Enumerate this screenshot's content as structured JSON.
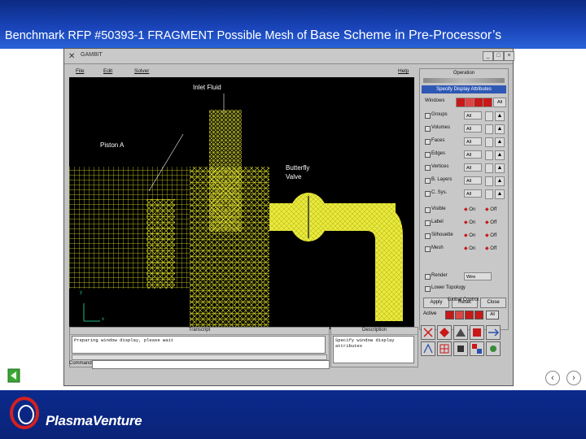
{
  "slide": {
    "title_main": "Benchmark  RFP #50393-1  FRAGMENT Possible Mesh of ",
    "title_emph": "Base Scheme in Pre-Processor’s",
    "brand": "PlasmaVenture"
  },
  "app": {
    "window_title": "GAMBIT",
    "menu": [
      "File",
      "Edit",
      "Solver",
      "Help"
    ],
    "canvas_labels": {
      "inlet": "Inlet Fluid",
      "piston": "Piston A",
      "butterfly": "Butterfly\nValve",
      "axis_y": "y",
      "axis_x": "x"
    },
    "operation": "Operation",
    "display_header": "Specify Display Attributes",
    "windows_label": "Windows",
    "all_label": "All",
    "entity_rows": [
      {
        "label": "Groups",
        "opt": "All"
      },
      {
        "label": "Volumes",
        "opt": "All"
      },
      {
        "label": "Faces",
        "opt": "All"
      },
      {
        "label": "Edges",
        "opt": "All"
      },
      {
        "label": "Vertices",
        "opt": "All"
      },
      {
        "label": "B. Layers",
        "opt": "All"
      },
      {
        "label": "C. Sys.",
        "opt": "All"
      }
    ],
    "toggle_rows": [
      {
        "label": "Visible",
        "on": "On",
        "off": "Off"
      },
      {
        "label": "Label",
        "on": "On",
        "off": "Off"
      },
      {
        "label": "Silhouette",
        "on": "On",
        "off": "Off"
      },
      {
        "label": "Mesh",
        "on": "On",
        "off": "Off"
      }
    ],
    "render_label": "Render",
    "render_value": "Wire",
    "lower_topology": "Lower Topology",
    "buttons": [
      "Apply",
      "Reset",
      "Close"
    ],
    "global_control": "Global Control",
    "active_label": "Active",
    "transcript_title": "Transcript",
    "transcript_text": "Preparing window display, please wait",
    "command_label": "Command:",
    "description_title": "Description",
    "description_text": "Specify window display attributes",
    "status_corner": "GAMBIT"
  },
  "colors": {
    "mesh": "#e6e62a",
    "fluid_fill": "#eaea3a",
    "title_bar": "#1943b7",
    "selection_blue": "#2f58b5"
  }
}
